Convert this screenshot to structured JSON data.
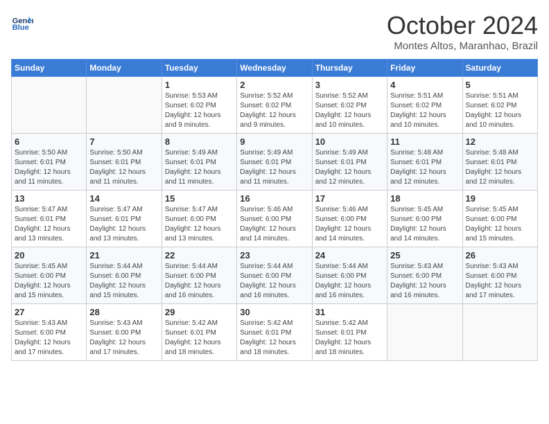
{
  "header": {
    "logo_line1": "General",
    "logo_line2": "Blue",
    "month": "October 2024",
    "location": "Montes Altos, Maranhao, Brazil"
  },
  "days_of_week": [
    "Sunday",
    "Monday",
    "Tuesday",
    "Wednesday",
    "Thursday",
    "Friday",
    "Saturday"
  ],
  "weeks": [
    [
      {
        "day": "",
        "info": ""
      },
      {
        "day": "",
        "info": ""
      },
      {
        "day": "1",
        "info": "Sunrise: 5:53 AM\nSunset: 6:02 PM\nDaylight: 12 hours and 9 minutes."
      },
      {
        "day": "2",
        "info": "Sunrise: 5:52 AM\nSunset: 6:02 PM\nDaylight: 12 hours and 9 minutes."
      },
      {
        "day": "3",
        "info": "Sunrise: 5:52 AM\nSunset: 6:02 PM\nDaylight: 12 hours and 10 minutes."
      },
      {
        "day": "4",
        "info": "Sunrise: 5:51 AM\nSunset: 6:02 PM\nDaylight: 12 hours and 10 minutes."
      },
      {
        "day": "5",
        "info": "Sunrise: 5:51 AM\nSunset: 6:02 PM\nDaylight: 12 hours and 10 minutes."
      }
    ],
    [
      {
        "day": "6",
        "info": "Sunrise: 5:50 AM\nSunset: 6:01 PM\nDaylight: 12 hours and 11 minutes."
      },
      {
        "day": "7",
        "info": "Sunrise: 5:50 AM\nSunset: 6:01 PM\nDaylight: 12 hours and 11 minutes."
      },
      {
        "day": "8",
        "info": "Sunrise: 5:49 AM\nSunset: 6:01 PM\nDaylight: 12 hours and 11 minutes."
      },
      {
        "day": "9",
        "info": "Sunrise: 5:49 AM\nSunset: 6:01 PM\nDaylight: 12 hours and 11 minutes."
      },
      {
        "day": "10",
        "info": "Sunrise: 5:49 AM\nSunset: 6:01 PM\nDaylight: 12 hours and 12 minutes."
      },
      {
        "day": "11",
        "info": "Sunrise: 5:48 AM\nSunset: 6:01 PM\nDaylight: 12 hours and 12 minutes."
      },
      {
        "day": "12",
        "info": "Sunrise: 5:48 AM\nSunset: 6:01 PM\nDaylight: 12 hours and 12 minutes."
      }
    ],
    [
      {
        "day": "13",
        "info": "Sunrise: 5:47 AM\nSunset: 6:01 PM\nDaylight: 12 hours and 13 minutes."
      },
      {
        "day": "14",
        "info": "Sunrise: 5:47 AM\nSunset: 6:01 PM\nDaylight: 12 hours and 13 minutes."
      },
      {
        "day": "15",
        "info": "Sunrise: 5:47 AM\nSunset: 6:00 PM\nDaylight: 12 hours and 13 minutes."
      },
      {
        "day": "16",
        "info": "Sunrise: 5:46 AM\nSunset: 6:00 PM\nDaylight: 12 hours and 14 minutes."
      },
      {
        "day": "17",
        "info": "Sunrise: 5:46 AM\nSunset: 6:00 PM\nDaylight: 12 hours and 14 minutes."
      },
      {
        "day": "18",
        "info": "Sunrise: 5:45 AM\nSunset: 6:00 PM\nDaylight: 12 hours and 14 minutes."
      },
      {
        "day": "19",
        "info": "Sunrise: 5:45 AM\nSunset: 6:00 PM\nDaylight: 12 hours and 15 minutes."
      }
    ],
    [
      {
        "day": "20",
        "info": "Sunrise: 5:45 AM\nSunset: 6:00 PM\nDaylight: 12 hours and 15 minutes."
      },
      {
        "day": "21",
        "info": "Sunrise: 5:44 AM\nSunset: 6:00 PM\nDaylight: 12 hours and 15 minutes."
      },
      {
        "day": "22",
        "info": "Sunrise: 5:44 AM\nSunset: 6:00 PM\nDaylight: 12 hours and 16 minutes."
      },
      {
        "day": "23",
        "info": "Sunrise: 5:44 AM\nSunset: 6:00 PM\nDaylight: 12 hours and 16 minutes."
      },
      {
        "day": "24",
        "info": "Sunrise: 5:44 AM\nSunset: 6:00 PM\nDaylight: 12 hours and 16 minutes."
      },
      {
        "day": "25",
        "info": "Sunrise: 5:43 AM\nSunset: 6:00 PM\nDaylight: 12 hours and 16 minutes."
      },
      {
        "day": "26",
        "info": "Sunrise: 5:43 AM\nSunset: 6:00 PM\nDaylight: 12 hours and 17 minutes."
      }
    ],
    [
      {
        "day": "27",
        "info": "Sunrise: 5:43 AM\nSunset: 6:00 PM\nDaylight: 12 hours and 17 minutes."
      },
      {
        "day": "28",
        "info": "Sunrise: 5:43 AM\nSunset: 6:00 PM\nDaylight: 12 hours and 17 minutes."
      },
      {
        "day": "29",
        "info": "Sunrise: 5:42 AM\nSunset: 6:01 PM\nDaylight: 12 hours and 18 minutes."
      },
      {
        "day": "30",
        "info": "Sunrise: 5:42 AM\nSunset: 6:01 PM\nDaylight: 12 hours and 18 minutes."
      },
      {
        "day": "31",
        "info": "Sunrise: 5:42 AM\nSunset: 6:01 PM\nDaylight: 12 hours and 18 minutes."
      },
      {
        "day": "",
        "info": ""
      },
      {
        "day": "",
        "info": ""
      }
    ]
  ]
}
